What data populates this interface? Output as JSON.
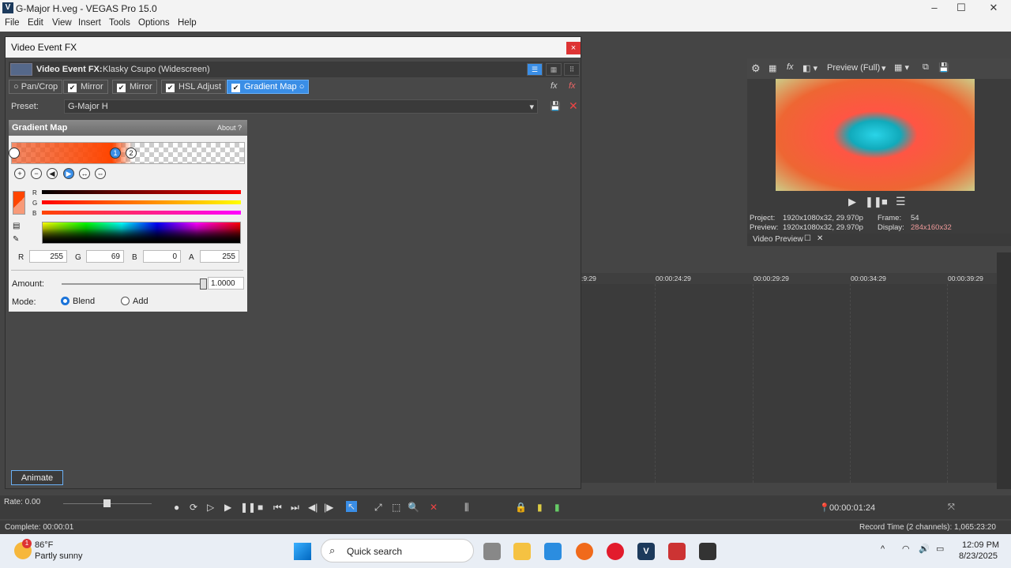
{
  "window": {
    "title": "G-Major H.veg - VEGAS Pro 15.0"
  },
  "menu": [
    "File",
    "Edit",
    "View",
    "Insert",
    "Tools",
    "Options",
    "Help"
  ],
  "dialog": {
    "title": "Video Event FX",
    "close": "×",
    "fx_label": "Video Event FX:",
    "fx_event": "Klasky Csupo (Widescreen)",
    "chain": [
      {
        "label": "Pan/Crop",
        "checked": false
      },
      {
        "label": "Mirror",
        "checked": true
      },
      {
        "label": "Mirror",
        "checked": true
      },
      {
        "label": "HSL Adjust",
        "checked": true
      },
      {
        "label": "Gradient Map",
        "checked": true,
        "selected": true
      }
    ],
    "preset_label": "Preset:",
    "preset_value": "G-Major H",
    "animate": "Animate"
  },
  "gradient_map": {
    "title": "Gradient Map",
    "about": "About  ?",
    "stops": [
      "1",
      "2"
    ],
    "channel_r": "R",
    "channel_g": "G",
    "channel_b": "B",
    "r_label": "R",
    "r": "255",
    "g_label": "G",
    "g": "69",
    "b_label": "B",
    "b": "0",
    "a_label": "A",
    "a": "255",
    "amount_label": "Amount:",
    "amount": "1.0000",
    "amount_fraction": 1.0,
    "mode_label": "Mode:",
    "mode_blend": "Blend",
    "mode_add": "Add",
    "selected_color": "#ff4500"
  },
  "preview": {
    "mode": "Preview (Full)",
    "project_label": "Project:",
    "project": "1920x1080x32, 29.970p",
    "preview_label": "Preview:",
    "preview": "1920x1080x32, 29.970p",
    "frame_label": "Frame:",
    "frame": "54",
    "display_label": "Display:",
    "display": "284x160x32",
    "tab": "Video Preview"
  },
  "timeline": {
    "ticks": [
      ":9:29",
      "00:00:24:29",
      "00:00:29:29",
      "00:00:34:29",
      "00:00:39:29"
    ],
    "rate": "Rate: 0.00",
    "time": "00:00:01:24",
    "complete": "Complete: 00:00:01",
    "record_time": "Record Time (2 channels): 1,065:23:20"
  },
  "taskbar": {
    "temp": "86°F",
    "weather": "Partly sunny",
    "search": "Quick search",
    "clock_time": "12:09 PM",
    "clock_date": "8/23/2025",
    "badge": "1"
  }
}
